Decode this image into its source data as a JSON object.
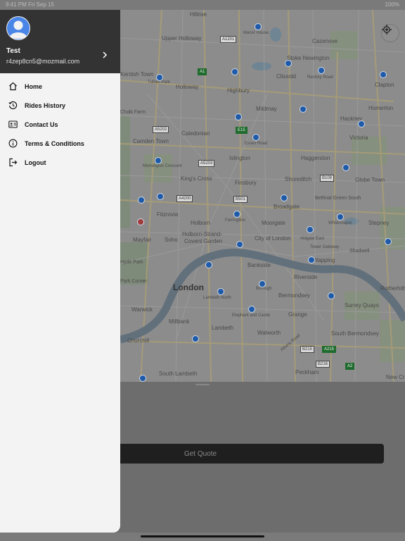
{
  "status_bar": {
    "time": "9:41 PM",
    "date": "Fri Sep 15",
    "right": "100%"
  },
  "map": {
    "labels": {
      "hillrise": "Hillrise",
      "upper_holloway": "Upper Holloway",
      "manor_house": "Manor House",
      "cazenove": "Cazenove",
      "stoke_newington": "Stoke Newington",
      "kentish_town": "Kentish Town",
      "tufnell_park": "Tufnell Park",
      "holloway": "Holloway",
      "clissold": "Clissold",
      "rectory_road": "Rectory Road",
      "clapton": "Clapton",
      "highbury": "Highbury",
      "mildmay": "Mildmay",
      "homerton": "Homerton",
      "chalk_farm": "Chalk Farm",
      "hackney": "Hackney",
      "caledonian": "Caledonian",
      "camden_town": "Camden Town",
      "essex_road": "Essex Road",
      "victoria": "Victoria",
      "islington": "Islington",
      "haggerston": "Haggerston",
      "mornington_crescent": "Mornington Crescent",
      "kings_cross": "King's Cross",
      "finsbury": "Finsbury",
      "shoreditch": "Shoreditch",
      "globe_town": "Globe Town",
      "bethnal_green": "Bethnal Green South",
      "fitzrovia": "Fitzrovia",
      "farringdon": "Farringdon",
      "broadgate": "Broadgate",
      "whitechapel": "Whitechapel",
      "stepney": "Stepney",
      "holborn": "Holborn",
      "moorgate": "Moorgate",
      "mayfair": "Mayfair",
      "soho": "Soho",
      "holborn_strand": "Holborn-Strand-",
      "covent_garden": "Covent Garden",
      "city_of_london": "City of London",
      "aldgate": "Aldgate East",
      "shadwell": "Shadwell",
      "hyde_park": "Hyde Park",
      "tower_gateway": "Tower Gateway",
      "wapping": "Wapping",
      "park_corner": "Park Corner",
      "london": "London",
      "bankside": "Bankside",
      "riverside": "Riverside",
      "rotherhithe": "Rotherhithe",
      "borough": "Borough",
      "bermondsey": "Bermondsey",
      "warwick": "Warwick",
      "lambeth_north": "Lambeth North",
      "surrey_quays": "Surrey Quays",
      "millbank": "Millbank",
      "lambeth": "Lambeth",
      "elephant": "Elephant and Castle",
      "grange": "Grange",
      "walworth": "Walworth",
      "churchill": "Churchill",
      "south_bermondsey": "South Bermondsey",
      "albany_road": "Albany Road",
      "south_lambeth": "South Lambeth",
      "peckham": "Peckham",
      "new_cross": "New Cro"
    },
    "road_tags": {
      "a1201": "A1201",
      "a1": "A1",
      "a503": "A503",
      "a5202": "A5202",
      "a5203": "A5203",
      "a1208": "A1208",
      "b108": "B108",
      "a4200": "A4200",
      "b501": "B501",
      "a215": "A215",
      "b215": "B215",
      "b216": "B216",
      "a2": "A2",
      "e15": "E15"
    }
  },
  "locate_icon": "crosshair-icon",
  "drawer": {
    "profile": {
      "name": "Test",
      "email": "r4zep8cn5@mozmail.com",
      "avatar_icon": "person-avatar-icon",
      "chevron_icon": "chevron-right-icon"
    },
    "menu": [
      {
        "label": "Home",
        "icon": "home-icon"
      },
      {
        "label": "Rides History",
        "icon": "history-icon"
      },
      {
        "label": "Contact Us",
        "icon": "contact-card-icon"
      },
      {
        "label": "Terms & Conditions",
        "icon": "info-icon"
      },
      {
        "label": "Logout",
        "icon": "logout-icon"
      }
    ]
  },
  "sheet": {
    "quote_button_label": "Get Quote"
  },
  "colors": {
    "drawer_header": "#333333",
    "drawer_bg": "#f3f3f3",
    "avatar_blue": "#4a86e8",
    "button_bg": "#1f1f1f"
  }
}
